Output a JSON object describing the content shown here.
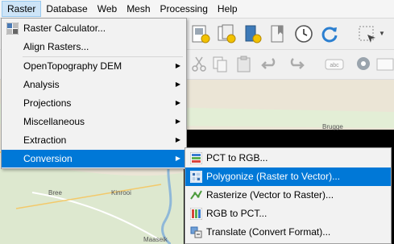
{
  "menubar": {
    "items": [
      {
        "label": "Raster",
        "active": true
      },
      {
        "label": "Database"
      },
      {
        "label": "Web"
      },
      {
        "label": "Mesh"
      },
      {
        "label": "Processing"
      },
      {
        "label": "Help"
      }
    ]
  },
  "raster_menu": {
    "items": [
      {
        "label": "Raster Calculator...",
        "icon": "raster-calculator-icon"
      },
      {
        "label": "Align Rasters..."
      },
      {
        "label": "OpenTopography DEM",
        "submenu": true
      },
      {
        "label": "Analysis",
        "submenu": true
      },
      {
        "label": "Projections",
        "submenu": true
      },
      {
        "label": "Miscellaneous",
        "submenu": true
      },
      {
        "label": "Extraction",
        "submenu": true
      },
      {
        "label": "Conversion",
        "submenu": true,
        "selected": true
      }
    ]
  },
  "conversion_submenu": {
    "items": [
      {
        "label": "PCT to RGB...",
        "icon": "pct-to-rgb-icon"
      },
      {
        "label": "Polygonize (Raster to Vector)...",
        "icon": "polygonize-icon",
        "highlighted": true
      },
      {
        "label": "Rasterize (Vector to Raster)...",
        "icon": "rasterize-icon"
      },
      {
        "label": "RGB to PCT...",
        "icon": "rgb-to-pct-icon"
      },
      {
        "label": "Translate (Convert Format)...",
        "icon": "translate-icon"
      }
    ]
  },
  "map": {
    "labels": [
      "Brugge",
      "Bree",
      "Kinrooi",
      "Maaseik"
    ]
  },
  "colors": {
    "highlight": "#0078d7",
    "menu_bg": "#f2f2f2"
  }
}
